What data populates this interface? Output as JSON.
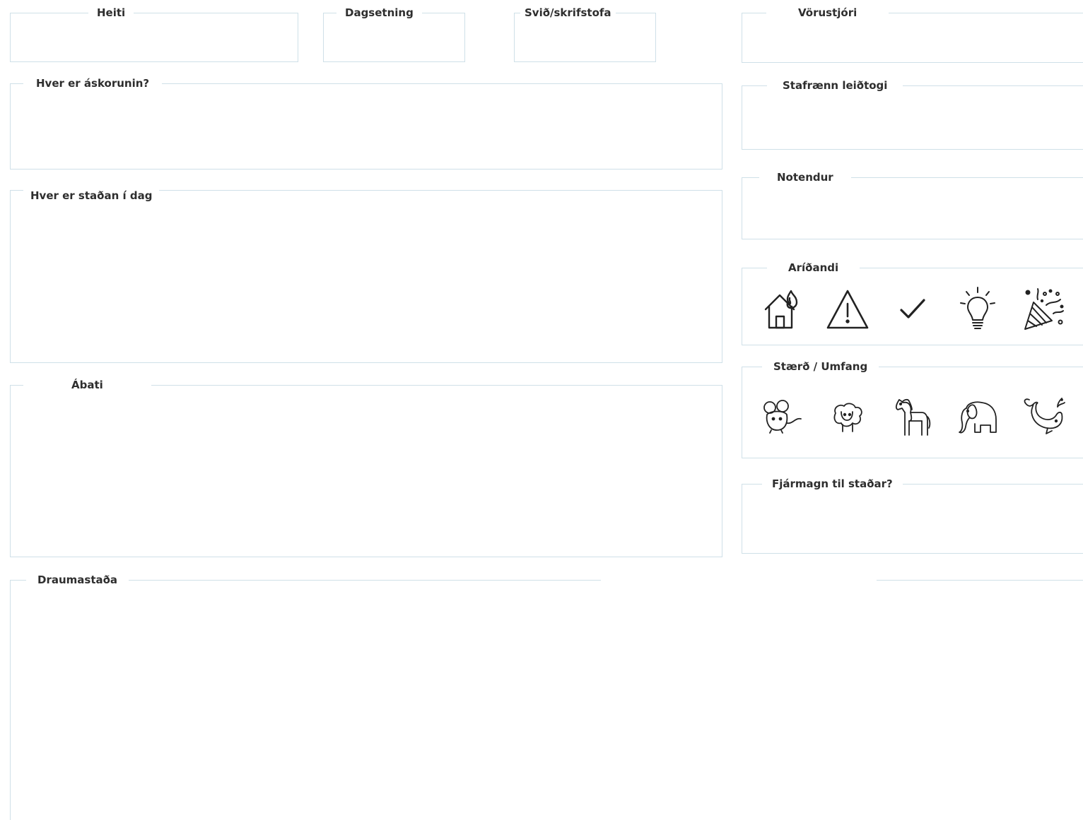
{
  "fields": {
    "heiti": {
      "label": "Heiti"
    },
    "dagsetning": {
      "label": "Dagsetning"
    },
    "svid": {
      "label": "Svið/skrifstofa"
    },
    "vorustjori": {
      "label": "Vörustjóri"
    },
    "askorun": {
      "label": "Hver er áskorunin?"
    },
    "stafraenn": {
      "label": "Stafrænn leiðtogi"
    },
    "notendur": {
      "label": "Notendur"
    },
    "stada": {
      "label": "Hver er staðan í dag"
    },
    "aridandi": {
      "label": "Aríðandi"
    },
    "staerd": {
      "label": "Stærð / Umfang"
    },
    "abati": {
      "label": "Ábati"
    },
    "fjarmagn": {
      "label": "Fjármagn til staðar?"
    },
    "draumastada": {
      "label": "Draumastaða"
    }
  },
  "urgency_icons": [
    "house-fire-icon",
    "warning-triangle-icon",
    "checkmark-icon",
    "lightbulb-icon",
    "party-popper-icon"
  ],
  "size_icons": [
    "mouse-icon",
    "sheep-icon",
    "horse-icon",
    "elephant-icon",
    "whale-icon"
  ],
  "colors": {
    "border": "#cfe0e8",
    "text": "#2e2e2e",
    "icon": "#222222"
  }
}
